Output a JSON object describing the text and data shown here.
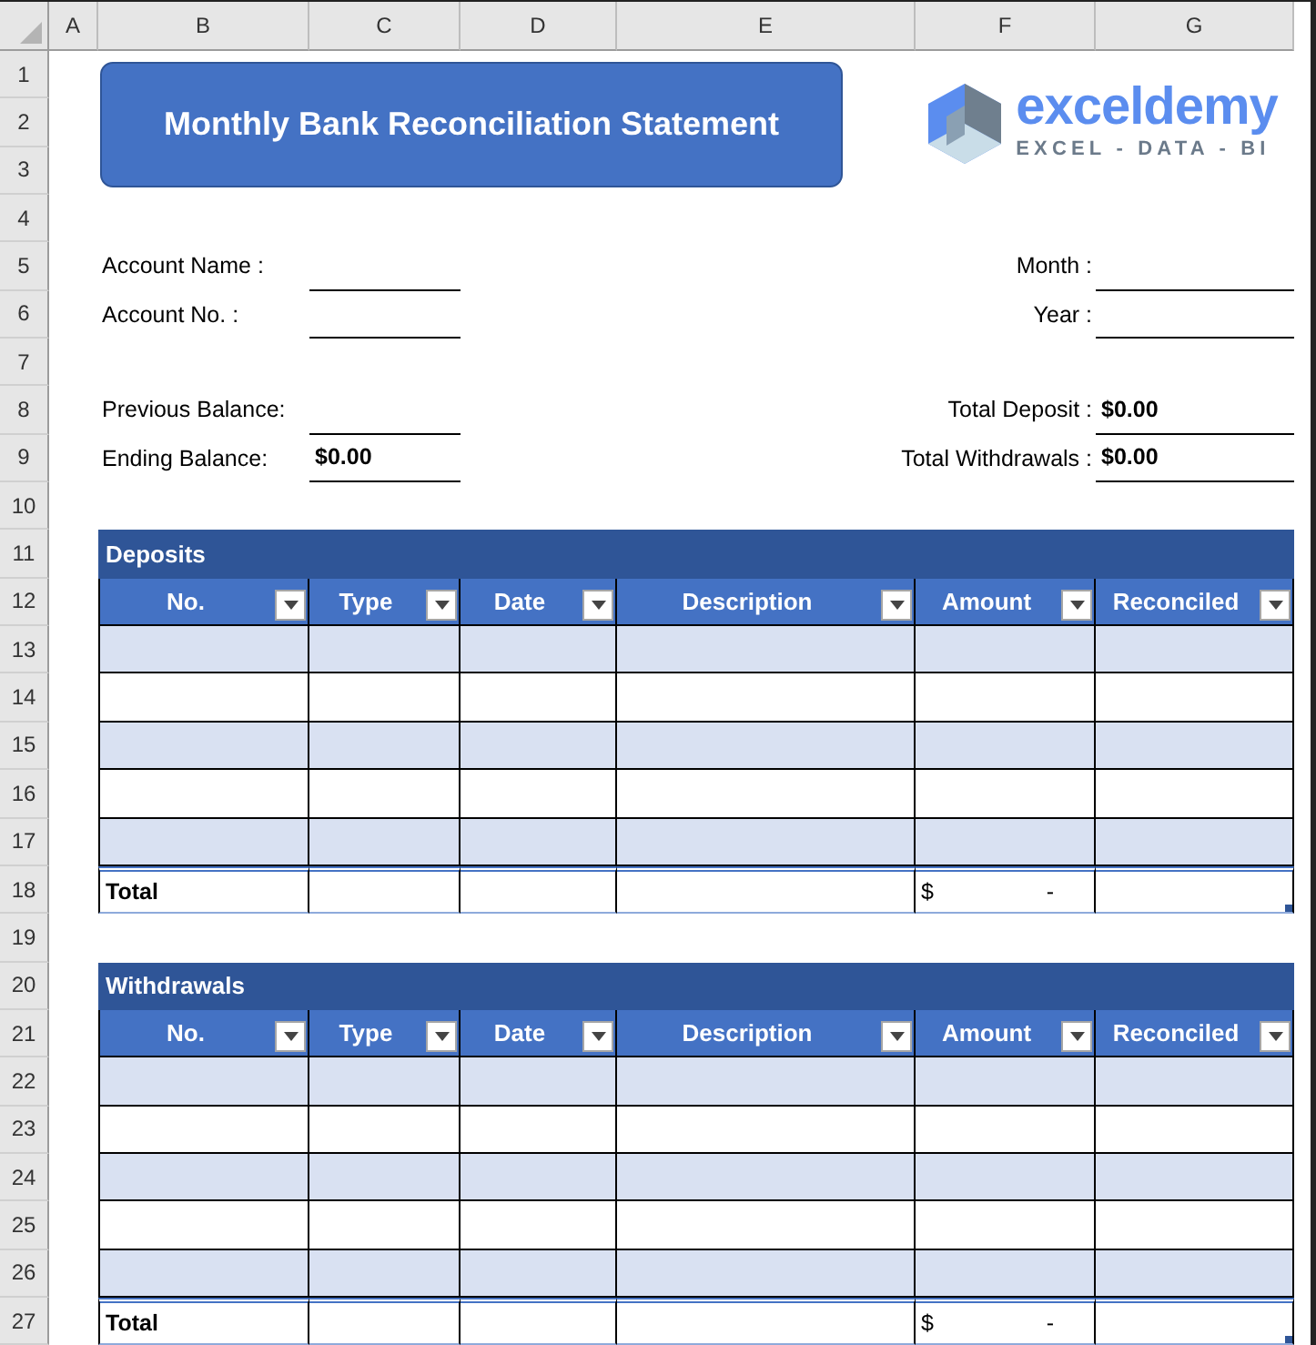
{
  "sheet": {
    "column_headers": [
      "A",
      "B",
      "C",
      "D",
      "E",
      "F",
      "G"
    ],
    "row_headers": [
      "1",
      "2",
      "3",
      "4",
      "5",
      "6",
      "7",
      "8",
      "9",
      "10",
      "11",
      "12",
      "13",
      "14",
      "15",
      "16",
      "17",
      "18",
      "19",
      "20",
      "21",
      "22",
      "23",
      "24",
      "25",
      "26",
      "27"
    ]
  },
  "title": "Monthly Bank Reconciliation Statement",
  "logo": {
    "wordmark": "exceldemy",
    "tagline": "EXCEL - DATA - BI"
  },
  "account_fields": [
    {
      "label": "Account Name :"
    },
    {
      "label": "Account No. :"
    }
  ],
  "period_fields": [
    {
      "label": "Month :"
    },
    {
      "label": "Year :"
    }
  ],
  "balance_fields": [
    {
      "label": "Previous Balance:"
    },
    {
      "label": "Ending Balance:",
      "value": "$0.00"
    }
  ],
  "total_fields": [
    {
      "label": "Total Deposit :",
      "value": "$0.00"
    },
    {
      "label": "Total Withdrawals :",
      "value": "$0.00"
    }
  ],
  "tables": [
    {
      "title": "Deposits",
      "columns": [
        "No.",
        "Type",
        "Date",
        "Description",
        "Amount",
        "Reconciled"
      ],
      "total": {
        "label": "Total",
        "currency": "$",
        "amount": "-"
      }
    },
    {
      "title": "Withdrawals",
      "columns": [
        "No.",
        "Type",
        "Date",
        "Description",
        "Amount",
        "Reconciled"
      ],
      "total": {
        "label": "Total",
        "currency": "$",
        "amount": "-"
      }
    }
  ]
}
